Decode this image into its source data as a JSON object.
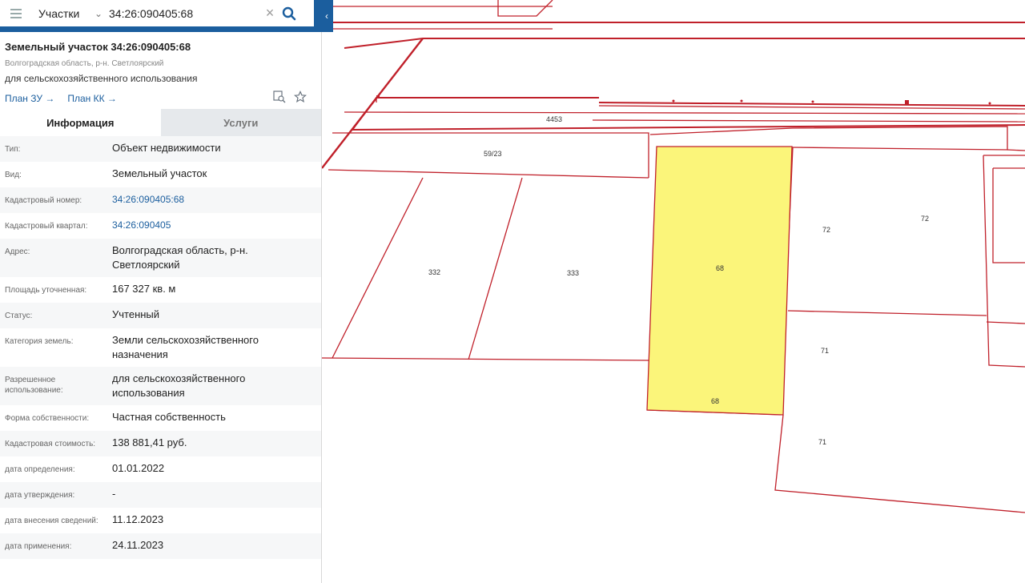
{
  "search": {
    "type_label": "Участки",
    "query": "34:26:090405:68"
  },
  "object": {
    "title": "Земельный участок 34:26:090405:68",
    "region": "Волгоградская область, р-н. Светлоярский",
    "use": "для сельскохозяйственного использования",
    "plan_zu": "План ЗУ",
    "plan_kk": "План КК"
  },
  "tabs": {
    "info": "Информация",
    "services": "Услуги"
  },
  "rows": [
    {
      "key": "Тип:",
      "value": "Объект недвижимости"
    },
    {
      "key": "Вид:",
      "value": "Земельный участок"
    },
    {
      "key": "Кадастровый номер:",
      "value": "34:26:090405:68"
    },
    {
      "key": "Кадастровый квартал:",
      "value": "34:26:090405"
    },
    {
      "key": "Адрес:",
      "value": "Волгоградская область, р-н. Светлоярский"
    },
    {
      "key": "Площадь уточненная:",
      "value": "167 327 кв. м"
    },
    {
      "key": "Статус:",
      "value": "Учтенный"
    },
    {
      "key": "Категория земель:",
      "value": "Земли сельскохозяйственного назначения"
    },
    {
      "key": "Разрешенное использование:",
      "value": "для сельскохозяйственного использования"
    },
    {
      "key": "Форма собственности:",
      "value": "Частная собственность"
    },
    {
      "key": "Кадастровая стоимость:",
      "value": "138 881,41 руб."
    },
    {
      "key": "дата определения:",
      "value": "01.01.2022"
    },
    {
      "key": "дата утверждения:",
      "value": "-"
    },
    {
      "key": "дата внесения сведений:",
      "value": "11.12.2023"
    },
    {
      "key": "дата применения:",
      "value": "24.11.2023"
    }
  ],
  "map_labels": {
    "l4453": "4453",
    "l5923": "59/23",
    "l332": "332",
    "l333": "333",
    "l68a": "68",
    "l68b": "68",
    "l72a": "72",
    "l72b": "72",
    "l71a": "71",
    "l71b": "71"
  },
  "colors": {
    "accent": "#1b5e9e",
    "parcel_line": "#c0202a",
    "selected_fill": "#fbf57a"
  }
}
